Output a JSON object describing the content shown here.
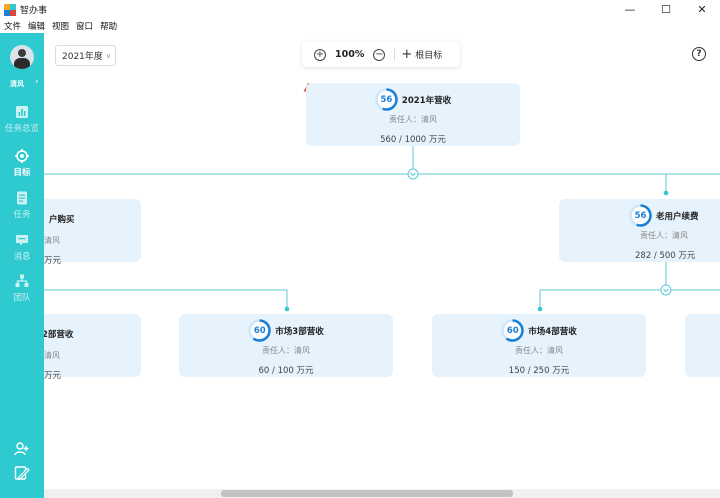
{
  "window": {
    "title": "智办事",
    "minimize": "—",
    "maximize": "☐",
    "close": "✕"
  },
  "menu": [
    "文件",
    "编辑",
    "视图",
    "窗口",
    "帮助"
  ],
  "sidebar": {
    "user_name": "清风",
    "items": [
      {
        "label": "任务总览",
        "icon": "bar-chart-icon"
      },
      {
        "label": "目标",
        "icon": "target-icon",
        "active": true
      },
      {
        "label": "任务",
        "icon": "document-icon"
      },
      {
        "label": "消息",
        "icon": "message-icon"
      },
      {
        "label": "团队",
        "icon": "team-icon"
      }
    ],
    "bottom_icons": [
      "add-user-icon",
      "edit-icon"
    ]
  },
  "toolbar": {
    "year": "2021年度",
    "zoom": "100%",
    "add_root": "根目标",
    "help": "?"
  },
  "nodes": [
    {
      "id": "root",
      "progress": 56,
      "title": "2021年营收",
      "owner": "责任人：清风",
      "amount": "560 / 1000 万元",
      "warning": true
    },
    {
      "id": "new-users",
      "progress": null,
      "title": "户购买",
      "owner": "清风",
      "amount": "万元"
    },
    {
      "id": "old-users",
      "progress": 56,
      "title": "老用户续费",
      "owner": "责任人：清风",
      "amount": "282 / 500 万元"
    },
    {
      "id": "market2",
      "progress": null,
      "title": "2部营收",
      "owner": "清风",
      "amount": "万元"
    },
    {
      "id": "market3",
      "progress": 60,
      "title": "市场3部营收",
      "owner": "责任人：清风",
      "amount": "60 / 100 万元"
    },
    {
      "id": "market4",
      "progress": 60,
      "title": "市场4部营收",
      "owner": "责任人：清风",
      "amount": "150 / 250 万元"
    }
  ],
  "colors": {
    "sidebar": "#2ecad0",
    "node_bg": "#e6f2fc",
    "connector": "#5cc9d6",
    "progress": "#1a7fd6",
    "warning": "#e0473b"
  }
}
